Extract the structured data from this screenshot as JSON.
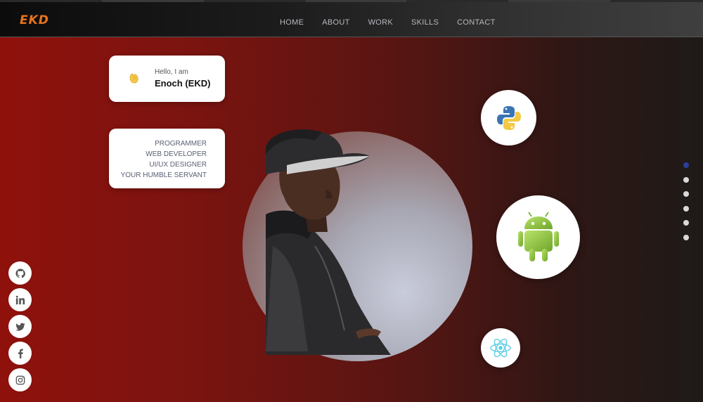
{
  "brand": {
    "logo_text": "EKD",
    "logo_color": "#e8741c"
  },
  "nav": {
    "items": [
      {
        "label": "HOME"
      },
      {
        "label": "ABOUT"
      },
      {
        "label": "WORK"
      },
      {
        "label": "SKILLS"
      },
      {
        "label": "CONTACT"
      }
    ]
  },
  "hero": {
    "greeting": "Hello, I am",
    "name": "Enoch (EKD)",
    "roles": [
      "PROGRAMMER",
      "WEB DEVELOPER",
      "UI/UX DESIGNER",
      "YOUR HUMBLE SERVANT"
    ]
  },
  "floating_icons": [
    "python-icon",
    "android-icon",
    "react-icon"
  ],
  "section_dots": {
    "count": 6,
    "active_index": 0,
    "active_color": "#2c3e9e"
  },
  "socials": [
    "github-icon",
    "linkedin-icon",
    "twitter-icon",
    "facebook-icon",
    "instagram-icon"
  ]
}
